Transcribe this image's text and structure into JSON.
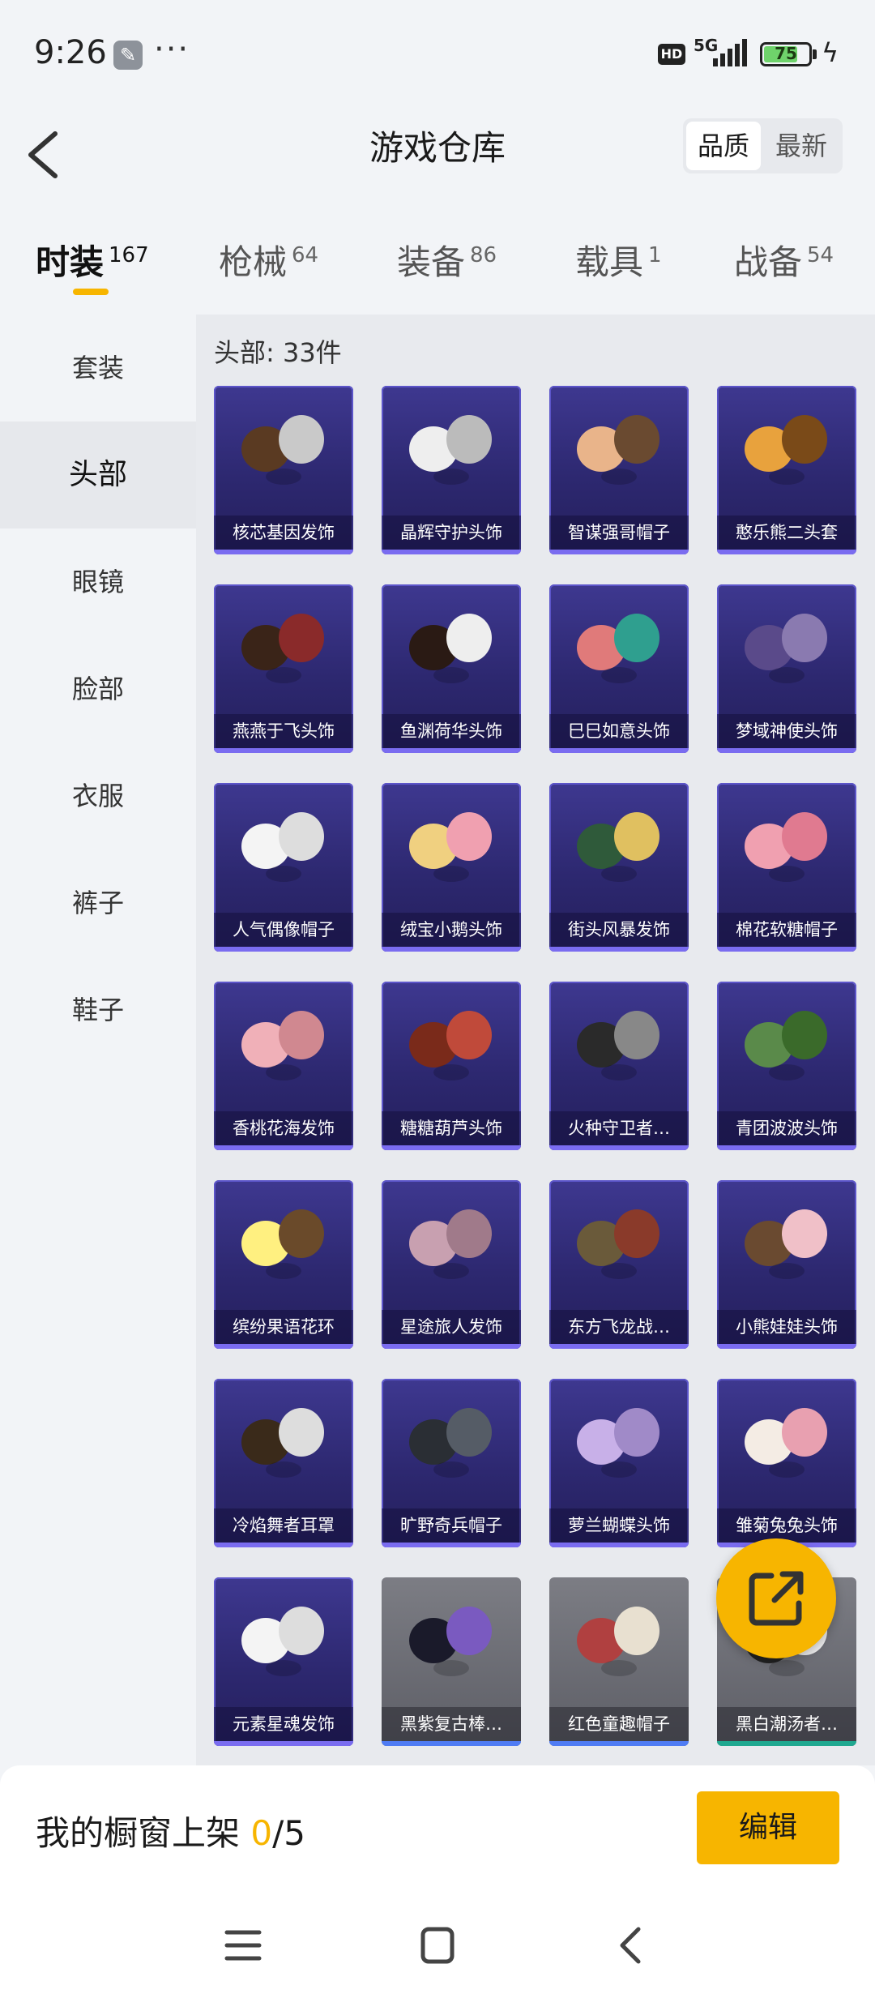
{
  "status_bar": {
    "time": "9:26",
    "dots": "···",
    "hd": "HD",
    "network": "5G",
    "battery": "75",
    "battery_level": 0.75
  },
  "header": {
    "title": "游戏仓库",
    "sort": [
      "品质",
      "最新"
    ]
  },
  "tabs": [
    {
      "label": "时装",
      "count": "167"
    },
    {
      "label": "枪械",
      "count": "64"
    },
    {
      "label": "装备",
      "count": "86"
    },
    {
      "label": "载具",
      "count": "1"
    },
    {
      "label": "战备",
      "count": "54"
    }
  ],
  "sidebar": [
    "套装",
    "头部",
    "眼镜",
    "脸部",
    "衣服",
    "裤子",
    "鞋子"
  ],
  "section_label": "头部: 33件",
  "items": [
    "核芯基因发饰",
    "晶辉守护头饰",
    "智谋强哥帽子",
    "憨乐熊二头套",
    "燕燕于飞头饰",
    "鱼渊荷华头饰",
    "巳巳如意头饰",
    "梦域神使头饰",
    "人气偶像帽子",
    "绒宝小鹅头饰",
    "街头风暴发饰",
    "棉花软糖帽子",
    "香桃花海发饰",
    "糖糖葫芦头饰",
    "火种守卫者…",
    "青团波波头饰",
    "缤纷果语花环",
    "星途旅人发饰",
    "东方飞龙战…",
    "小熊娃娃头饰",
    "冷焰舞者耳罩",
    "旷野奇兵帽子",
    "萝兰蝴蝶头饰",
    "雏菊兔兔头饰",
    "元素星魂发饰",
    "黑紫复古棒…",
    "红色童趣帽子",
    "黑白潮汤者…"
  ],
  "bottom": {
    "shelf_label": "我的橱窗上架",
    "shelf_current": "0",
    "shelf_total": "/5",
    "edit_label": "编辑"
  },
  "colors": {
    "accent": "#f7b500",
    "card_purple": "#2d2870",
    "card_gray": "#5d5e66"
  },
  "icons": [
    "wrench-icon",
    "back-chevron-icon",
    "share-icon",
    "menu-icon",
    "home-square-icon",
    "back-nav-icon"
  ]
}
